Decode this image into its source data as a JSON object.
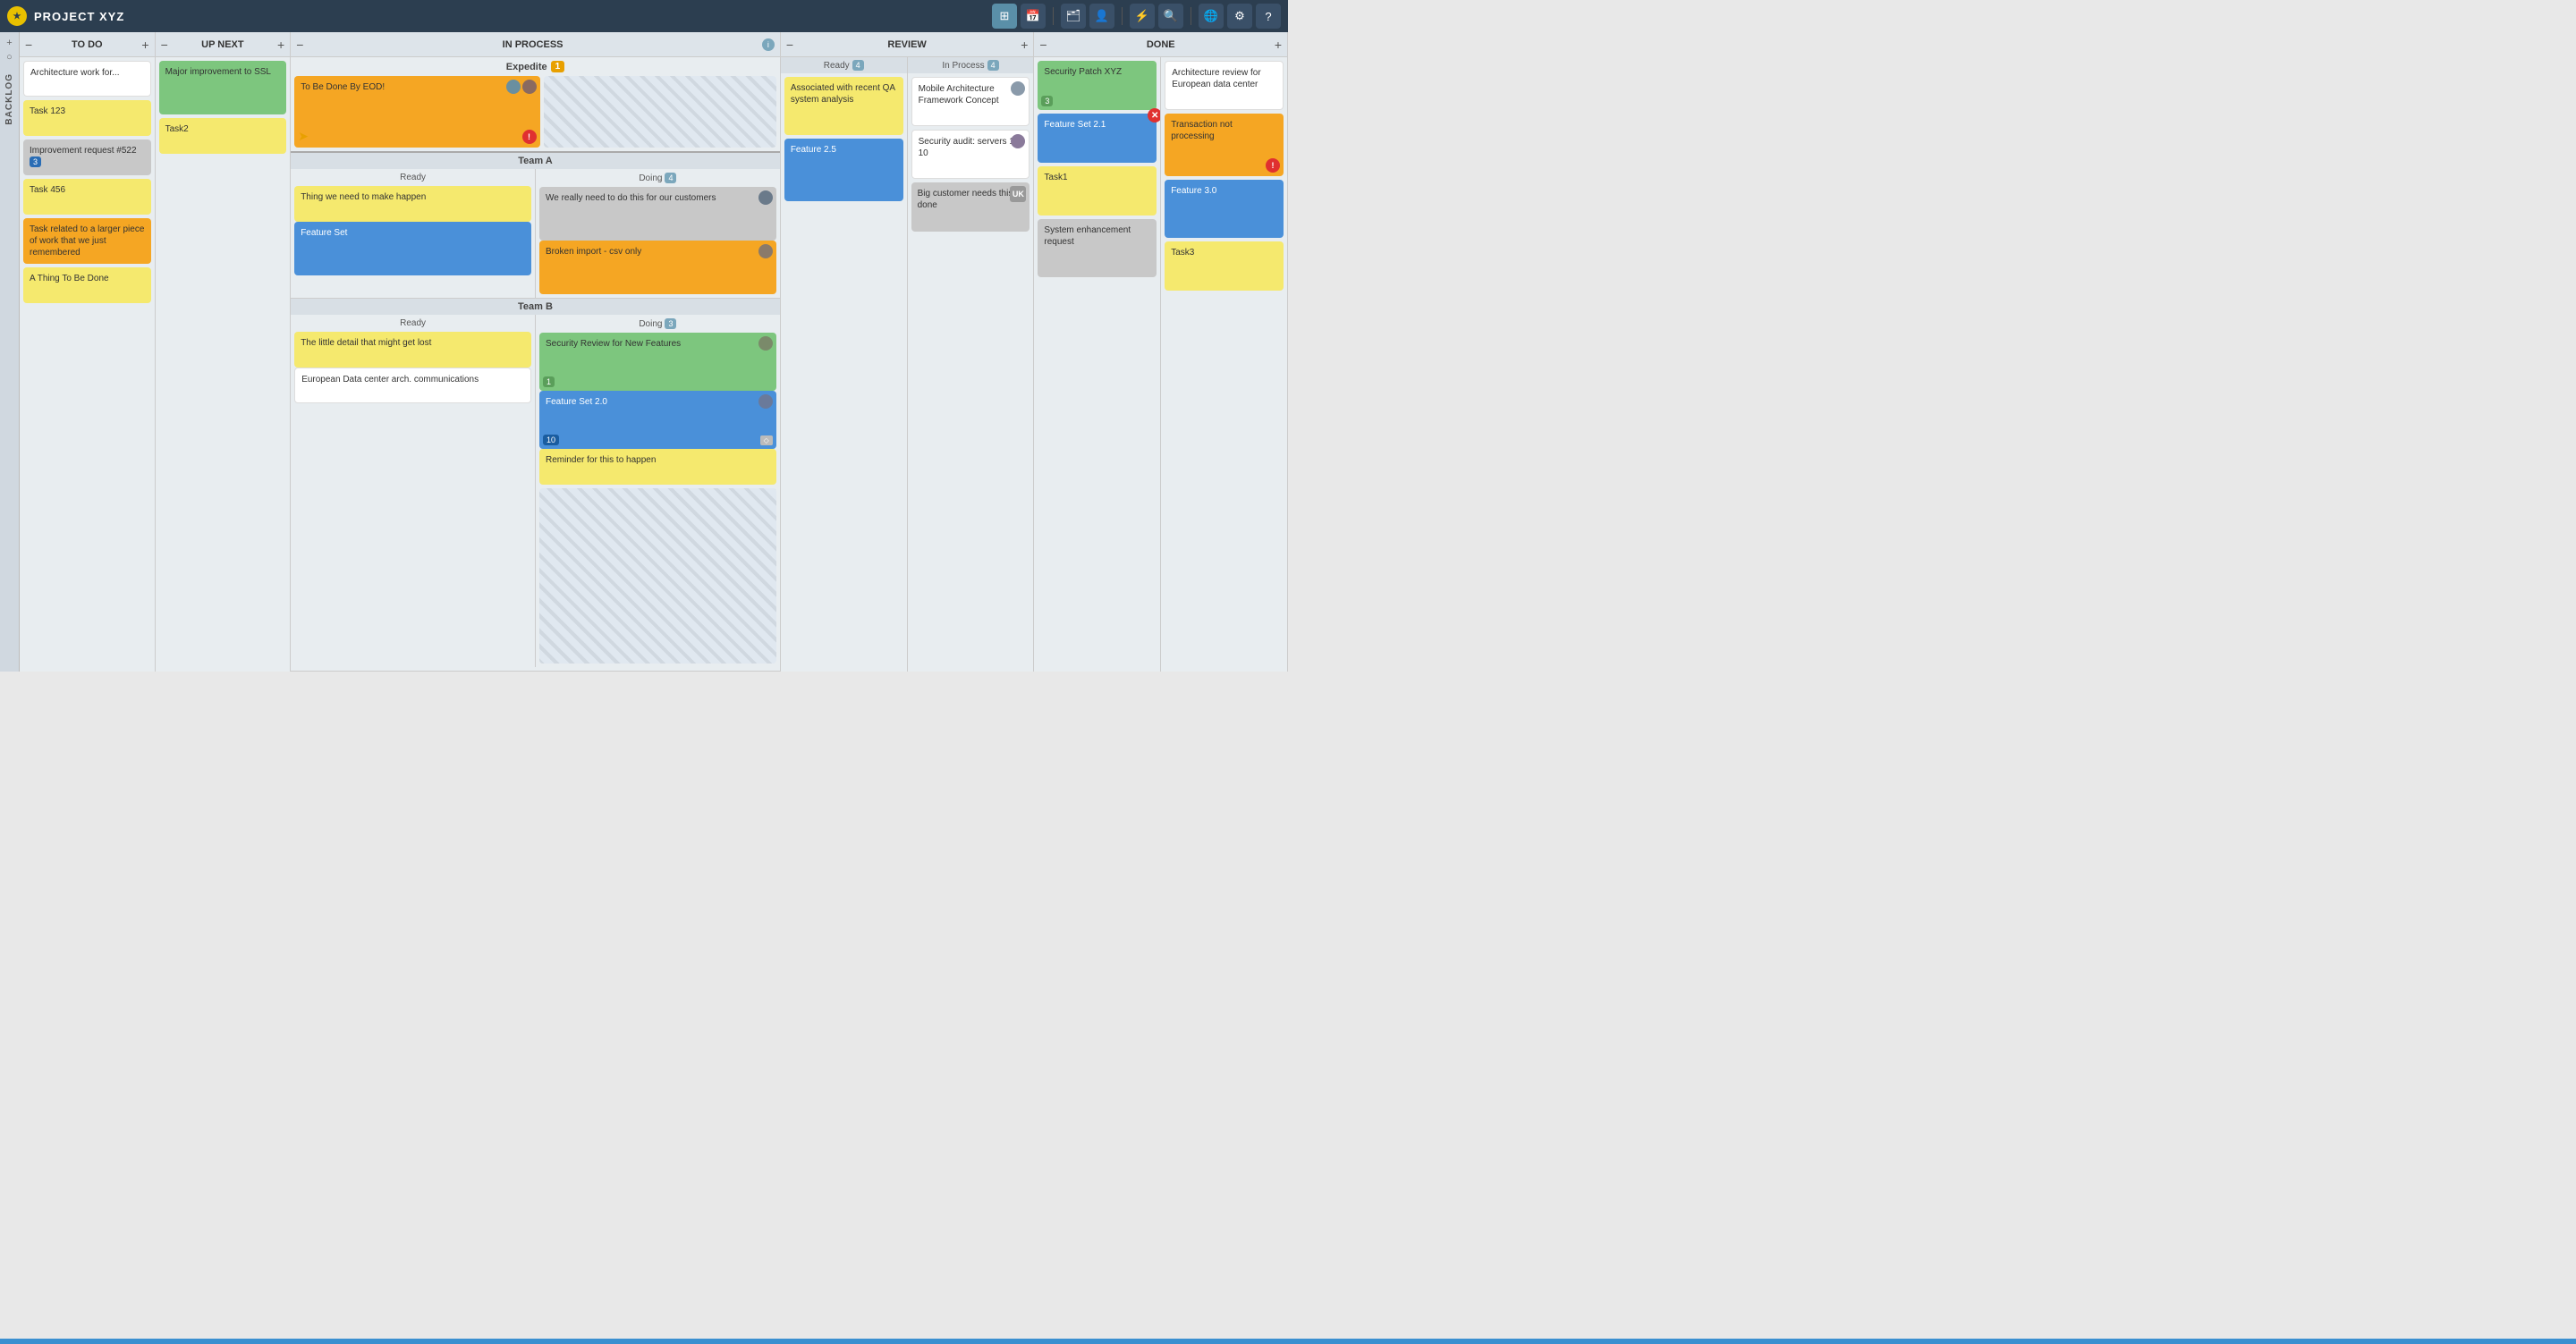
{
  "header": {
    "logo": "★",
    "title": "PROJECT XYZ",
    "icons": [
      "⊞",
      "📅",
      "🗂",
      "👤",
      "⚡",
      "🔍",
      "🌐",
      "⚙",
      "?"
    ]
  },
  "backlog": {
    "label": "BACKLOG",
    "icon": "+"
  },
  "columns": {
    "todo": {
      "label": "TO DO",
      "cards": [
        {
          "text": "Architecture work for...",
          "color": "white"
        },
        {
          "text": "Task 123",
          "color": "yellow"
        },
        {
          "text": "Improvement request #522",
          "color": "gray",
          "badge": "3"
        },
        {
          "text": "Task 456",
          "color": "yellow"
        },
        {
          "text": "Task related to a larger piece of work that we just remembered",
          "color": "orange"
        },
        {
          "text": "A Thing To Be Done",
          "color": "yellow"
        }
      ]
    },
    "upnext": {
      "label": "UP NEXT",
      "cards": [
        {
          "text": "Major improvement to SSL",
          "color": "green"
        },
        {
          "text": "Task2",
          "color": "yellow"
        }
      ]
    },
    "inprocess": {
      "label": "IN PROCESS",
      "info": true,
      "expedite": {
        "label": "Expedite",
        "count": "1",
        "card": {
          "text": "To Be Done By EOD!",
          "color": "orange",
          "has_avatar": true,
          "has_block": true,
          "has_priority": true
        }
      },
      "teams": [
        {
          "name": "Team A",
          "ready": {
            "label": "Ready",
            "cards": [
              {
                "text": "Thing we need to make happen",
                "color": "yellow"
              }
            ]
          },
          "doing": {
            "label": "Doing",
            "count": "4",
            "cards": [
              {
                "text": "We really need to do this for our customers",
                "color": "gray",
                "has_avatar": true
              },
              {
                "text": "Broken import - csv only",
                "color": "orange",
                "has_avatar": true
              }
            ]
          }
        },
        {
          "name": "Team B",
          "ready": {
            "label": "Ready",
            "cards": [
              {
                "text": "The little detail that might get lost",
                "color": "yellow"
              },
              {
                "text": "European Data center arch. communications",
                "color": "white"
              }
            ]
          },
          "doing": {
            "label": "Doing",
            "count": "3",
            "cards": [
              {
                "text": "Security Review for New Features",
                "color": "green",
                "has_avatar": true,
                "badge": "1"
              },
              {
                "text": "Feature Set 2.0",
                "color": "blue",
                "has_avatar": true,
                "badge": "10",
                "has_tag": true
              },
              {
                "text": "Reminder for this to happen",
                "color": "yellow"
              }
            ]
          }
        }
      ]
    },
    "review": {
      "label": "REVIEW",
      "ready": {
        "label": "Ready",
        "count": "4",
        "cards": [
          {
            "text": "Associated with recent QA system analysis",
            "color": "yellow"
          },
          {
            "text": "Feature 2.5",
            "color": "blue"
          }
        ]
      },
      "inprocess": {
        "label": "In Process",
        "count": "4",
        "cards": [
          {
            "text": "Mobile Architecture Framework Concept",
            "color": "white",
            "has_avatar": true
          },
          {
            "text": "Security audit: servers 1-10",
            "color": "white",
            "has_avatar": true
          },
          {
            "text": "Big customer needs this done",
            "color": "gray",
            "has_uk": true
          }
        ]
      }
    },
    "done": {
      "label": "DONE",
      "left": {
        "cards": [
          {
            "text": "Security Patch XYZ",
            "color": "green",
            "badge": "3"
          },
          {
            "text": "Feature Set 2.1",
            "color": "blue",
            "has_close": true
          },
          {
            "text": "Task1",
            "color": "yellow"
          },
          {
            "text": "System enhancement request",
            "color": "gray"
          }
        ]
      },
      "right": {
        "cards": [
          {
            "text": "Architecture review for European data center",
            "color": "white"
          },
          {
            "text": "Transaction not processing",
            "color": "orange",
            "has_priority": true
          },
          {
            "text": "Feature 3.0",
            "color": "blue"
          },
          {
            "text": "Task3",
            "color": "yellow"
          }
        ]
      }
    }
  }
}
